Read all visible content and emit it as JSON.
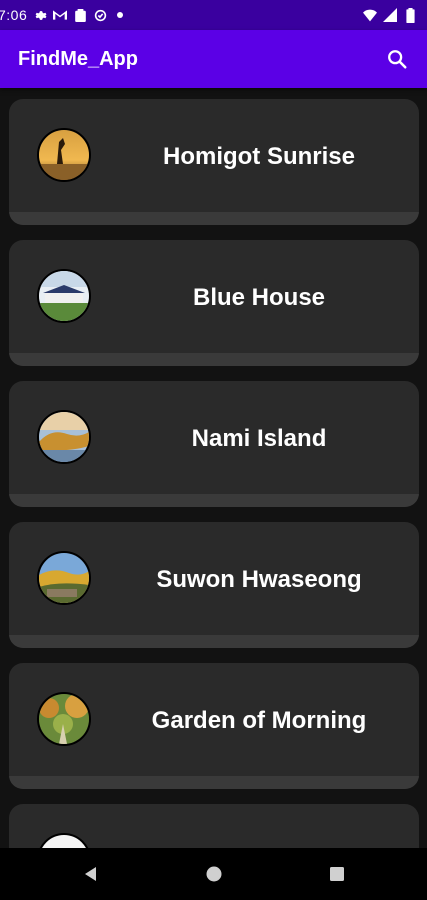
{
  "status_bar": {
    "time": "7:06"
  },
  "app_bar": {
    "title": "FindMe_App",
    "search_icon": "search-icon"
  },
  "places": [
    {
      "name": "Homigot Sunrise",
      "thumbnail": "sunrise-sculpture-photo"
    },
    {
      "name": "Blue House",
      "thumbnail": "blue-house-photo"
    },
    {
      "name": "Nami Island",
      "thumbnail": "nami-island-photo"
    },
    {
      "name": "Suwon Hwaseong",
      "thumbnail": "suwon-fortress-photo"
    },
    {
      "name": "Garden of Morning",
      "thumbnail": "garden-photo"
    },
    {
      "name": "",
      "thumbnail": "partially-visible-photo"
    }
  ],
  "nav_bar": {
    "back": "back-triangle-icon",
    "home": "home-circle-icon",
    "recents": "recents-square-icon"
  },
  "colors": {
    "status_bar": "#3a009f",
    "app_bar": "#5b00e6",
    "background": "#121212",
    "card": "#2a2a2a"
  }
}
